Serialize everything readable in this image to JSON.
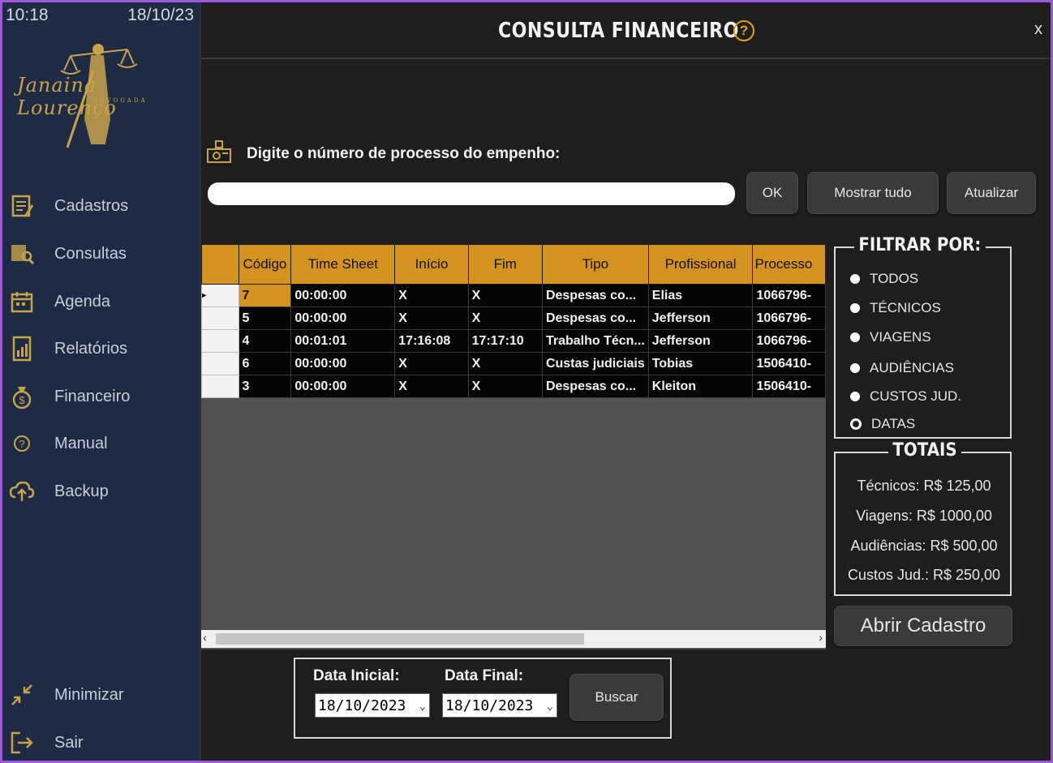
{
  "status": {
    "time": "10:18",
    "date": "18/10/23"
  },
  "logo": {
    "name": "Janaina Lourenço",
    "subtitle": "ADVOGADA"
  },
  "sidebar": {
    "items": [
      {
        "label": "Cadastros",
        "icon": "clipboard-icon"
      },
      {
        "label": "Consultas",
        "icon": "search-document-icon"
      },
      {
        "label": "Agenda",
        "icon": "calendar-icon"
      },
      {
        "label": "Relatórios",
        "icon": "report-icon"
      },
      {
        "label": "Financeiro",
        "icon": "money-bag-icon"
      },
      {
        "label": "Manual",
        "icon": "help-circle-icon"
      },
      {
        "label": "Backup",
        "icon": "cloud-upload-icon"
      }
    ],
    "minimize_label": "Minimizar",
    "exit_label": "Sair"
  },
  "header": {
    "title": "CONSULTA FINANCEIRO",
    "help": "?",
    "close": "x"
  },
  "search": {
    "prompt": "Digite o número de processo do empenho:",
    "value": "",
    "ok_label": "OK",
    "show_all_label": "Mostrar tudo",
    "refresh_label": "Atualizar"
  },
  "table": {
    "columns": [
      "Código",
      "Time Sheet",
      "Início",
      "Fim",
      "Tipo",
      "Profissional",
      "Processo"
    ],
    "rows": [
      [
        "7",
        "00:00:00",
        "X",
        "X",
        "Despesas co...",
        "Elias",
        "1066796-"
      ],
      [
        "5",
        "00:00:00",
        "X",
        "X",
        "Despesas co...",
        "Jefferson",
        "1066796-"
      ],
      [
        "4",
        "00:01:01",
        "17:16:08",
        "17:17:10",
        "Trabalho Técn...",
        "Jefferson",
        "1066796-"
      ],
      [
        "6",
        "00:00:00",
        "X",
        "X",
        "Custas judiciais",
        "Tobias",
        "1506410-"
      ],
      [
        "3",
        "00:00:00",
        "X",
        "X",
        "Despesas co...",
        "Kleiton",
        "1506410-"
      ]
    ]
  },
  "filter": {
    "title": "FILTRAR POR:",
    "options": [
      "TODOS",
      "TÉCNICOS",
      "VIAGENS",
      "AUDIÊNCIAS",
      "CUSTOS JUD.",
      "DATAS"
    ],
    "selected": "DATAS"
  },
  "totals": {
    "title": "TOTAIS",
    "lines": [
      "Técnicos: R$ 125,00",
      "Viagens: R$ 1000,00",
      "Audiências: R$ 500,00",
      "Custos Jud.: R$ 250,00"
    ]
  },
  "open_register_label": "Abrir Cadastro",
  "dates": {
    "start_label": "Data Inicial:",
    "start_value": "18/10/2023",
    "end_label": "Data Final:",
    "end_value": "18/10/2023",
    "search_label": "Buscar"
  },
  "colors": {
    "accent": "#d4921e",
    "sidebar": "#1d2b45",
    "gold": "#c9a24a"
  }
}
